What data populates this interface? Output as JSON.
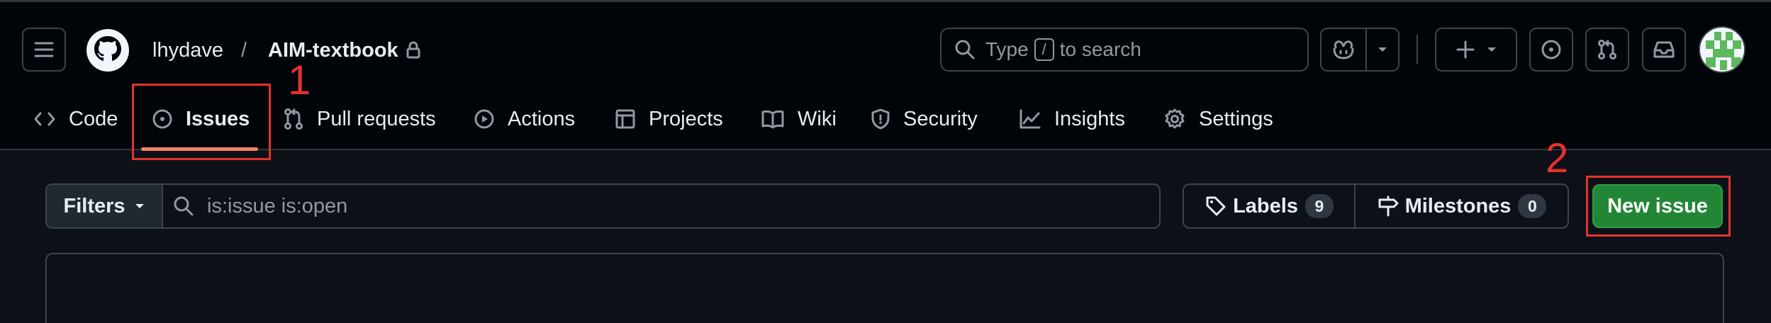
{
  "header": {
    "owner": "lhydave",
    "separator": "/",
    "repo": "AIM-textbook",
    "search": {
      "prefix": "Type",
      "key": "/",
      "suffix": "to search"
    }
  },
  "tabs": [
    {
      "label": "Code",
      "icon": "code-icon"
    },
    {
      "label": "Issues",
      "icon": "issue-opened-icon",
      "selected": true
    },
    {
      "label": "Pull requests",
      "icon": "git-pull-request-icon"
    },
    {
      "label": "Actions",
      "icon": "play-icon"
    },
    {
      "label": "Projects",
      "icon": "table-icon"
    },
    {
      "label": "Wiki",
      "icon": "book-icon"
    },
    {
      "label": "Security",
      "icon": "shield-icon"
    },
    {
      "label": "Insights",
      "icon": "graph-icon"
    },
    {
      "label": "Settings",
      "icon": "gear-icon"
    }
  ],
  "toolbar": {
    "filters_label": "Filters",
    "filter_value": "is:issue is:open",
    "labels_label": "Labels",
    "labels_count": "9",
    "milestones_label": "Milestones",
    "milestones_count": "0",
    "new_issue_label": "New issue"
  },
  "annotations": {
    "one": "1",
    "two": "2"
  },
  "colors": {
    "accent_underline": "#f78166",
    "primary_button": "#238636",
    "annotation": "#e5322d"
  }
}
